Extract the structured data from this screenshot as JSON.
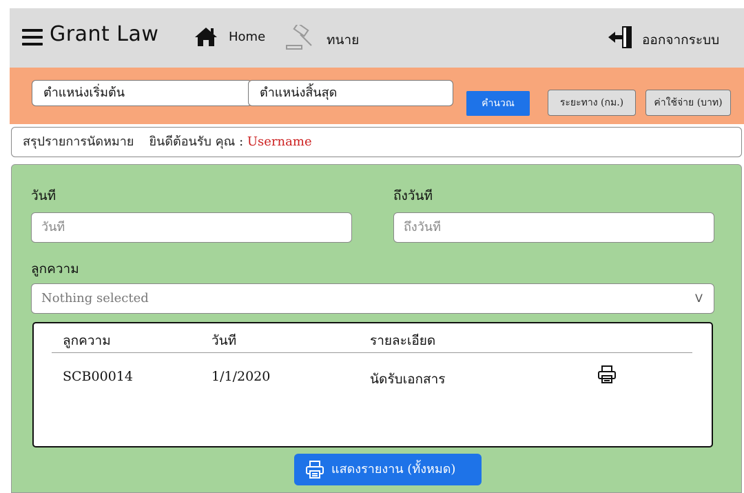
{
  "header": {
    "brand": "Grant Law",
    "home_label": "Home",
    "lawyer_label": "ทนาย",
    "logout_label": "ออกจากระบบ"
  },
  "route": {
    "start_value": "ตำแหน่งเริ่มต้น",
    "end_value": "ตำแหน่งสิ้นสุด",
    "calculate_label": "คำนวณ",
    "distance_label": "ระยะทาง (กม.)",
    "cost_label": "ค่าใช้จ่าย (บาท)"
  },
  "summary": {
    "title": "สรุปรายการนัดหมาย",
    "welcome": "ยินดีต้อนรับ คุณ :",
    "username": "Username"
  },
  "filters": {
    "date_label": "วันที",
    "date_placeholder": "วันที",
    "to_date_label": "ถึงวันที",
    "to_date_placeholder": "ถึงวันที",
    "client_label": "ลูกความ",
    "client_selected": "Nothing selected"
  },
  "table": {
    "headers": [
      "ลูกความ",
      "วันที",
      "รายละเอียด"
    ],
    "rows": [
      {
        "client": "SCB00014",
        "date": "1/1/2020",
        "detail": "นัดรับเอกสาร"
      }
    ]
  },
  "report_button_label": "แสดงรายงาน (ทั้งหมด)",
  "colors": {
    "header_bg": "#dcdcdc",
    "route_bar": "#f8a67a",
    "panel_green": "#a5d49a",
    "primary_blue": "#1e73e8",
    "username_red": "#cc2020"
  }
}
